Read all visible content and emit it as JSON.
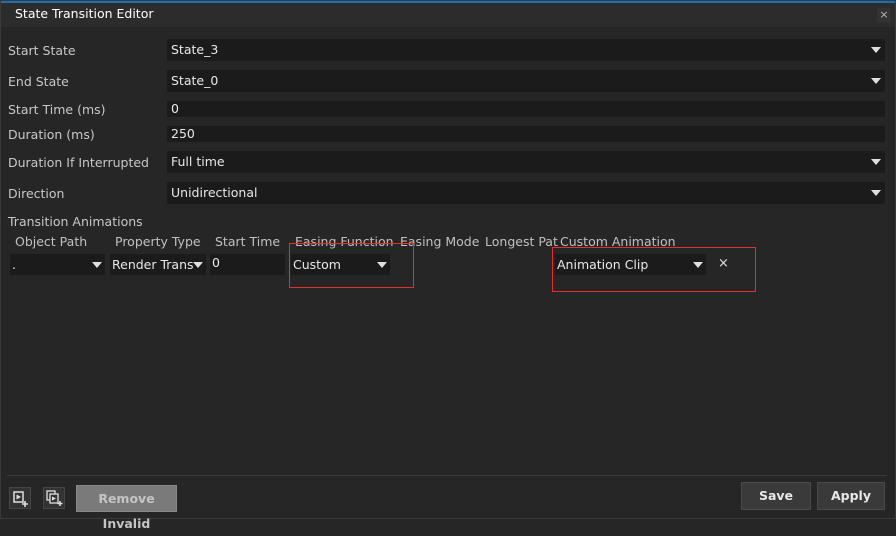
{
  "window": {
    "title": "State Transition Editor",
    "close_glyph": "×"
  },
  "form": {
    "start_state": {
      "label": "Start State",
      "value": "State_3"
    },
    "end_state": {
      "label": "End State",
      "value": "State_0"
    },
    "start_time": {
      "label": "Start Time (ms)",
      "value": "0"
    },
    "duration": {
      "label": "Duration (ms)",
      "value": "250"
    },
    "duration_interrupted": {
      "label": "Duration If Interrupted",
      "value": "Full time"
    },
    "direction": {
      "label": "Direction",
      "value": "Unidirectional"
    }
  },
  "animations": {
    "section_label": "Transition Animations",
    "columns": [
      "Object Path",
      "Property Type",
      "Start Time",
      "Easing Function",
      "Easing Mode",
      "Longest Patl",
      "Custom Animation"
    ],
    "row": {
      "object_path": ".",
      "property_type": "Render Trans",
      "start_time": "0",
      "easing_function": "Custom",
      "custom_animation": "Animation Clip",
      "remove_glyph": "×"
    }
  },
  "footer": {
    "add_icon": "add-animation-icon",
    "duplicate_icon": "duplicate-animation-icon",
    "remove_invalid_label": "Remove Invalid",
    "save_label": "Save",
    "apply_label": "Apply"
  },
  "colors": {
    "accent": "#1f6fb5",
    "highlight": "#e03030",
    "background": "#262626",
    "field": "#1b1b1b"
  }
}
